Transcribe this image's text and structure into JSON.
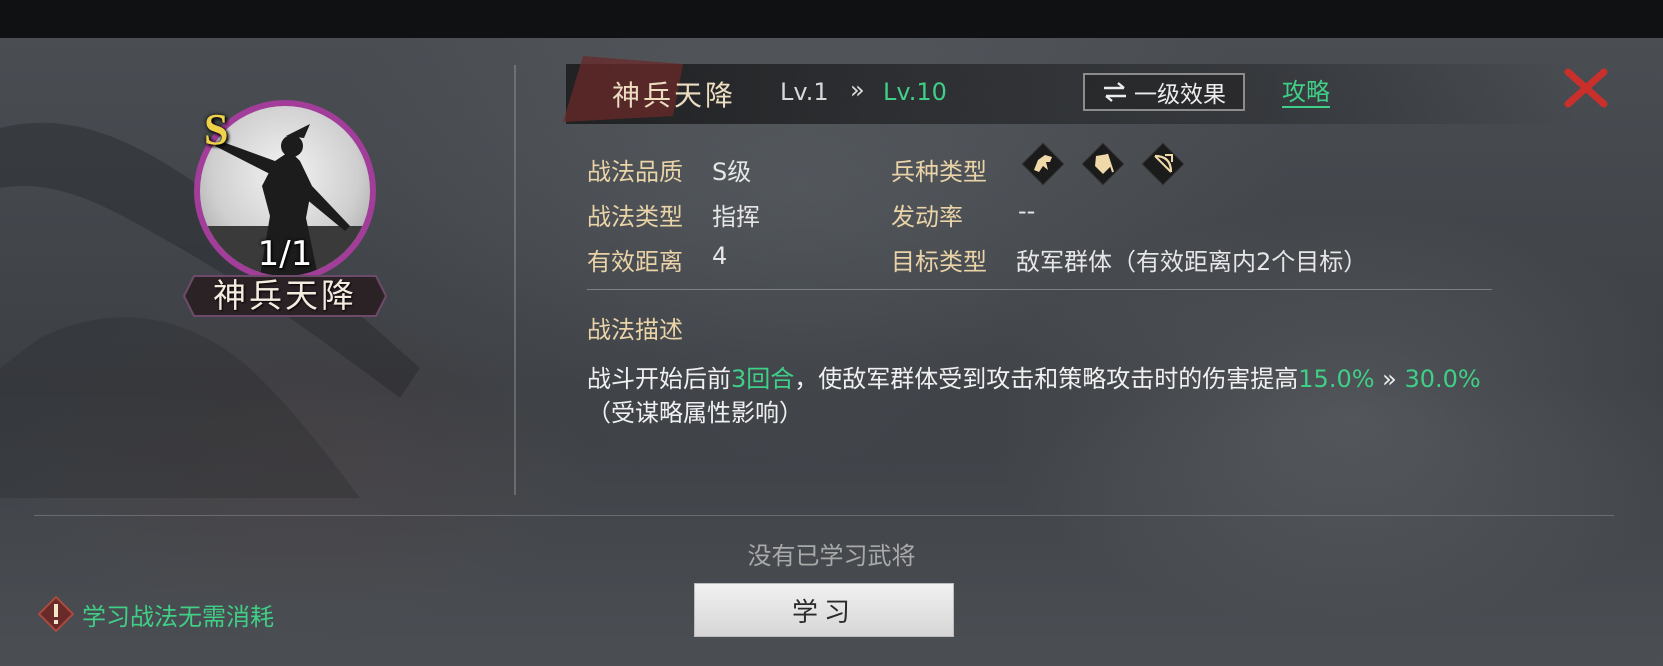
{
  "top_tabs": [
    "",
    "",
    "",
    "",
    "",
    "",
    ""
  ],
  "card": {
    "grade": "S",
    "count": "1/1",
    "name": "神兵天降"
  },
  "header": {
    "title": "神兵天降",
    "level_current": "Lv.1",
    "level_arrow": "»",
    "level_max": "Lv.10",
    "effect_button": "一级效果",
    "guide_link": "攻略"
  },
  "info": {
    "quality_label": "战法品质",
    "quality_value": "S级",
    "type_label": "战法类型",
    "type_value": "指挥",
    "range_label": "有效距离",
    "range_value": "4",
    "troop_label": "兵种类型",
    "troop_icons": [
      "cavalry-icon",
      "shield-icon",
      "archer-icon"
    ],
    "rate_label": "发动率",
    "rate_value": "--",
    "target_label": "目标类型",
    "target_value": "敌军群体（有效距离内2个目标）"
  },
  "description": {
    "title": "战法描述",
    "part1": "战斗开始后前",
    "hl1": "3回合",
    "part2": "，使敌军群体受到攻击和策略攻击时的伤害提高",
    "hl2": "15.0%",
    "arrow": " » ",
    "hl3": "30.0%",
    "part3": "（受谋略属性影响）"
  },
  "bottom": {
    "no_learned": "没有已学习武将",
    "learn_button": "学习",
    "tip": "学习战法无需消耗"
  },
  "colors": {
    "accent_green": "#3fcf86",
    "label_gold": "#e9d3a7",
    "close_red": "#c9302c",
    "portrait_border": "#a23d9a"
  }
}
